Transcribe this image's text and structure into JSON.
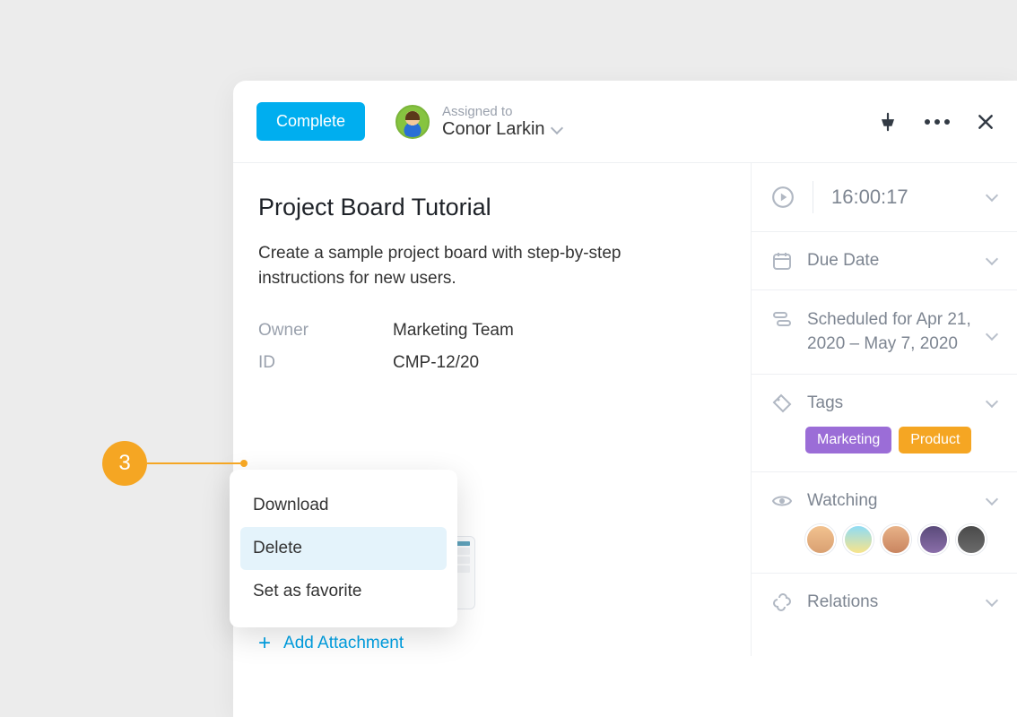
{
  "callout": {
    "number": "3"
  },
  "header": {
    "complete_label": "Complete",
    "assigned_label": "Assigned to",
    "assignee_name": "Conor Larkin"
  },
  "task": {
    "title": "Project Board Tutorial",
    "description": "Create a sample project board with step-by-step instructions for new users.",
    "meta": {
      "owner_label": "Owner",
      "owner_value": "Marketing Team",
      "id_label": "ID",
      "id_value": "CMP-12/20"
    },
    "add_attachment_label": "Add Attachment"
  },
  "context_menu": {
    "download": "Download",
    "delete": "Delete",
    "set_favorite": "Set as favorite"
  },
  "sidebar": {
    "timer_value": "16:00:17",
    "due_label": "Due Date",
    "schedule_text": "Scheduled for Apr 21, 2020 – May 7, 2020",
    "tags_label": "Tags",
    "tags": {
      "marketing": "Marketing",
      "product": "Product"
    },
    "watching_label": "Watching",
    "relations_label": "Relations"
  }
}
